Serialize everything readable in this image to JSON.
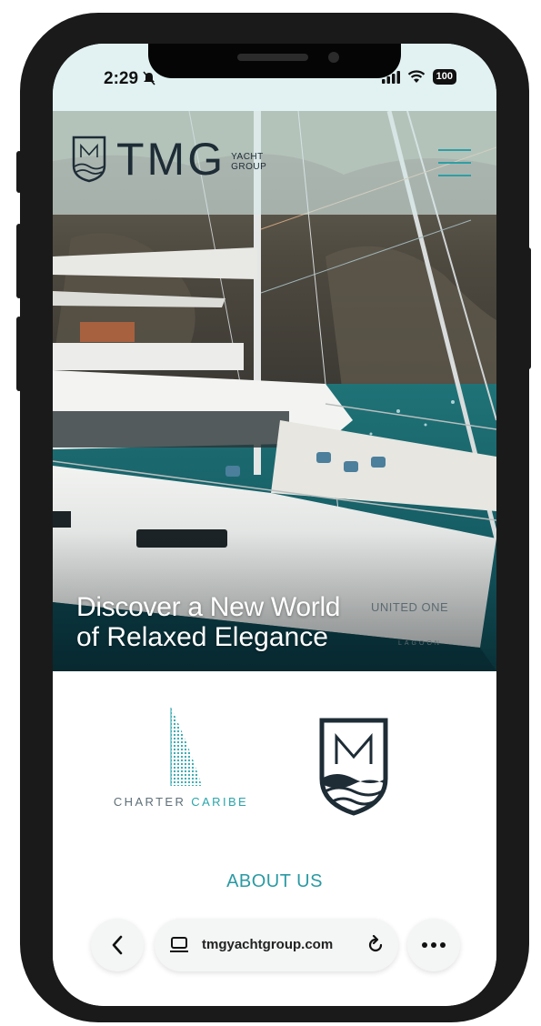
{
  "status_bar": {
    "time": "2:29",
    "battery": "100"
  },
  "site": {
    "logo_wordmark": "TMG",
    "logo_sub_line1": "YACHT",
    "logo_sub_line2": "GROUP",
    "hero_line1": "Discover a New World",
    "hero_line2_prefix": "of",
    "hero_line2_bold": "Relaxed Elegance",
    "boat_name": "UNITED ONE",
    "boat_brand": "LAGOON"
  },
  "partners": {
    "charter_caribe_part1": "CHARTER",
    "charter_caribe_part2": "CARIBE"
  },
  "section": {
    "about_us": "ABOUT US"
  },
  "browser": {
    "url": "tmgyachtgroup.com"
  },
  "colors": {
    "accent": "#2e9fa5",
    "logo_dark": "#1e2c36",
    "status_bg": "#e2f2f2"
  }
}
